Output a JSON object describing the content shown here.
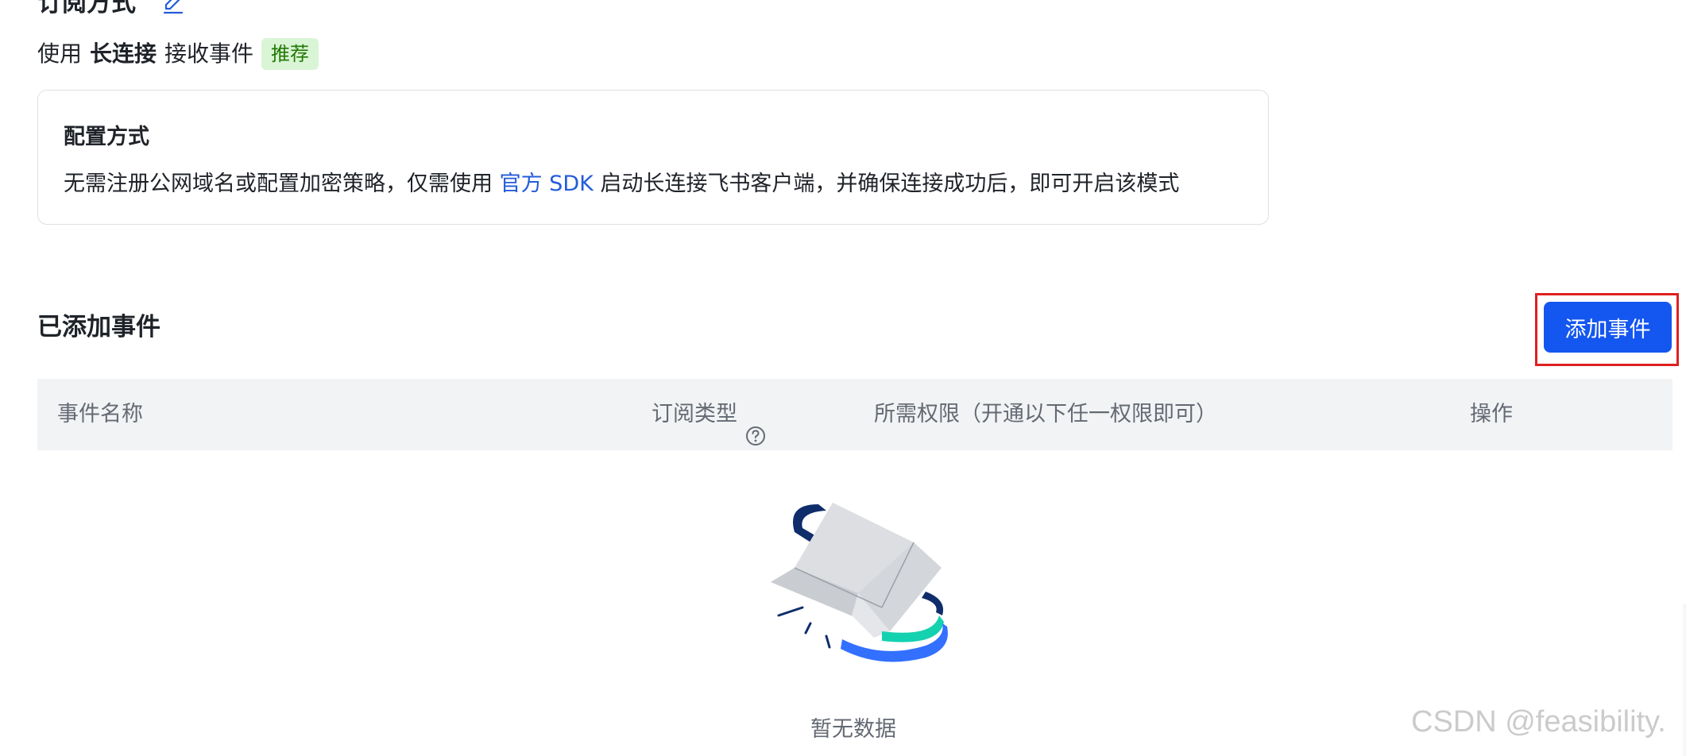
{
  "subscription": {
    "title": "订阅方式",
    "mode_prefix": "使用",
    "mode_bold": "长连接",
    "mode_suffix": "接收事件",
    "badge": "推荐"
  },
  "config": {
    "title": "配置方式",
    "desc_before": "无需注册公网域名或配置加密策略，仅需使用 ",
    "desc_link": "官方 SDK",
    "desc_after": " 启动长连接飞书客户端，并确保连接成功后，即可开启该模式"
  },
  "events": {
    "title": "已添加事件",
    "add_button": "添加事件",
    "columns": {
      "name": "事件名称",
      "type": "订阅类型",
      "permission": "所需权限（开通以下任一权限即可）",
      "ops": "操作"
    },
    "empty_text": "暂无数据"
  },
  "watermark": "CSDN @feasibility.",
  "colors": {
    "primary": "#1456f0",
    "link": "#245bdb",
    "badge_bg": "#d9f5d6",
    "badge_text": "#237804",
    "highlight": "#e02020",
    "table_header_bg": "#f2f3f5"
  },
  "icons": {
    "edit": "edit-icon",
    "help": "help-circle-icon",
    "empty": "empty-box-illustration"
  }
}
